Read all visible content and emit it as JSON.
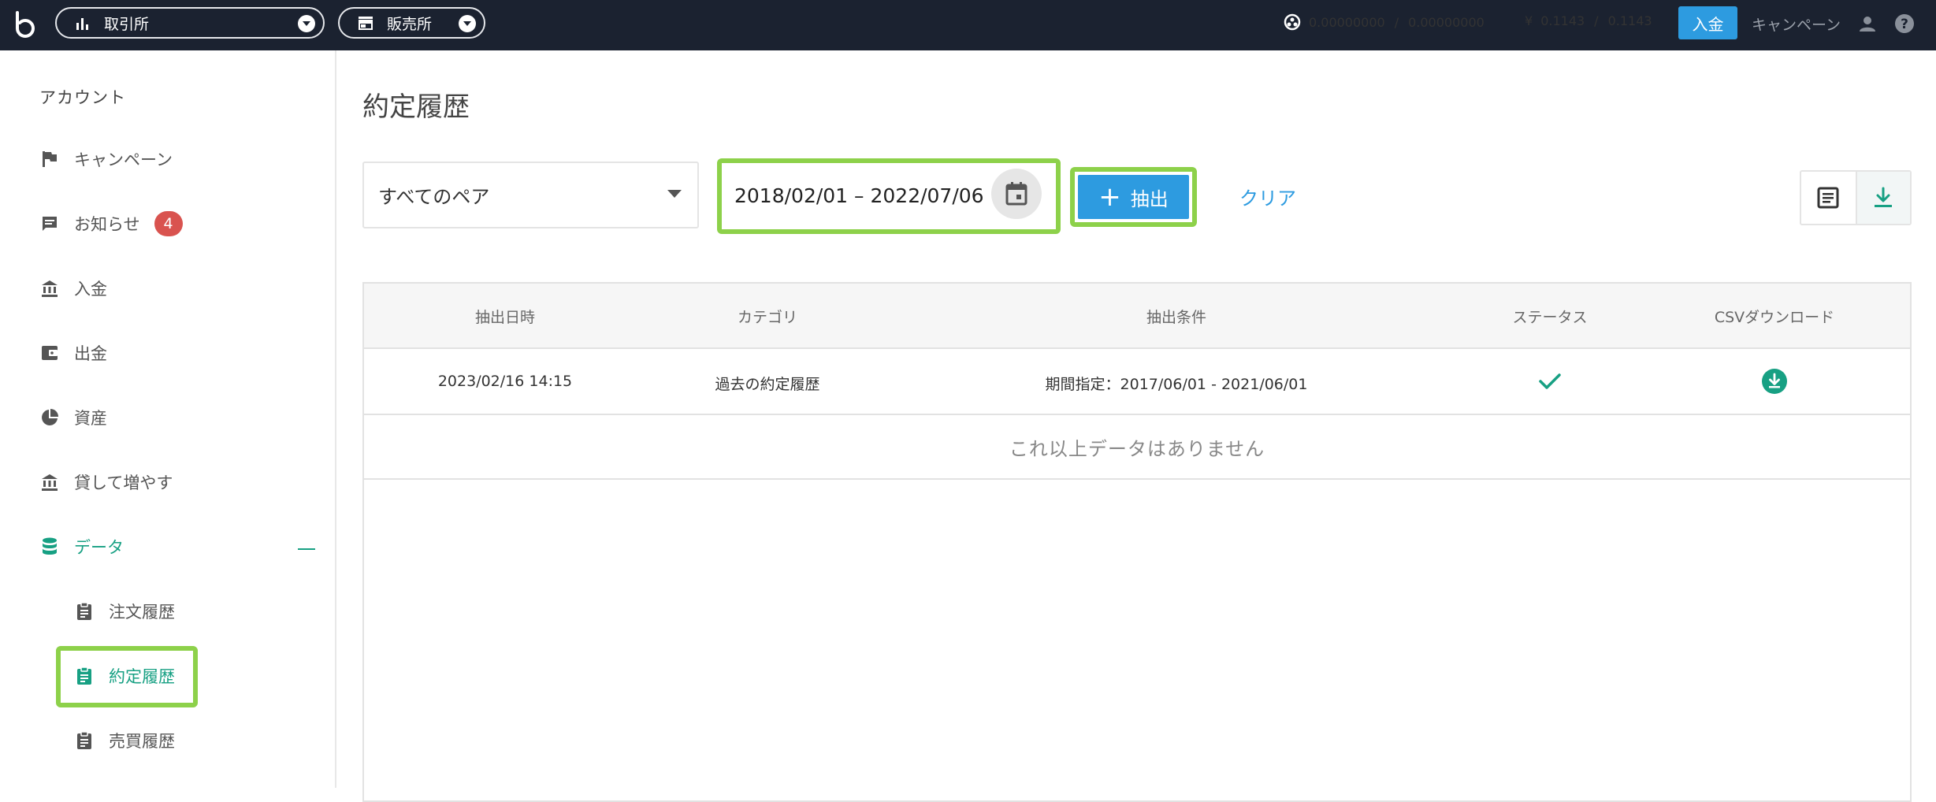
{
  "topbar": {
    "exchange_label": "取引所",
    "sales_label": "販売所",
    "btc_balance": "0.00000000",
    "btc_available": "0.00000000",
    "jpy_symbol": "¥",
    "jpy_balance": "0.1143",
    "jpy_available": "0.1143",
    "separator": "/",
    "deposit_label": "入金",
    "campaign_label": "キャンペーン",
    "icons": {
      "logo": "bitbank-logo-icon",
      "user": "user-icon",
      "help": "help-icon"
    }
  },
  "sidebar": {
    "heading": "アカウント",
    "items": [
      {
        "label": "キャンペーン",
        "icon": "flag-icon"
      },
      {
        "label": "お知らせ",
        "icon": "message-icon",
        "badge": "4"
      },
      {
        "label": "入金",
        "icon": "bank-icon"
      },
      {
        "label": "出金",
        "icon": "wallet-icon"
      },
      {
        "label": "資産",
        "icon": "pie-chart-icon"
      },
      {
        "label": "貸して増やす",
        "icon": "bank-icon"
      },
      {
        "label": "データ",
        "icon": "database-icon"
      }
    ],
    "sub_items": [
      {
        "label": "注文履歴",
        "icon": "clipboard-icon"
      },
      {
        "label": "約定履歴",
        "icon": "clipboard-icon"
      },
      {
        "label": "売買履歴",
        "icon": "clipboard-icon"
      }
    ]
  },
  "main": {
    "title": "約定履歴",
    "pair_select_value": "すべてのペア",
    "date_range": "2018/02/01 – 2022/07/06",
    "extract_label": "抽出",
    "clear_label": "クリア"
  },
  "table": {
    "headers": [
      "抽出日時",
      "カテゴリ",
      "抽出条件",
      "ステータス",
      "CSVダウンロード"
    ],
    "rows": [
      {
        "datetime": "2023/02/16 14:15",
        "category": "過去の約定履歴",
        "condition": "期間指定：2017/06/01 - 2021/06/01",
        "status_icon": "check-icon",
        "download_icon": "download-circle-icon"
      }
    ],
    "no_more": "これ以上データはありません"
  },
  "colors": {
    "topbar_bg": "#1b2230",
    "accent_green": "#17a083",
    "primary_blue": "#2d9be0",
    "badge_red": "#d9534f",
    "highlight": "#8dd14a"
  }
}
